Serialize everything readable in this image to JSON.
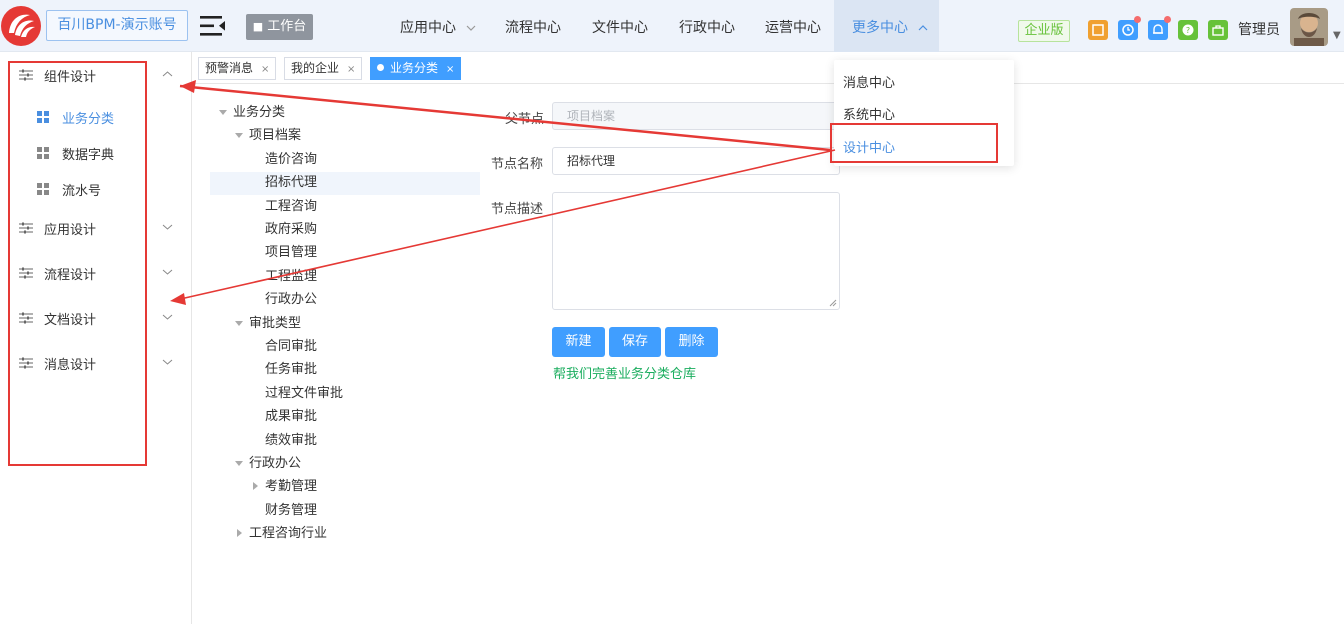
{
  "header": {
    "account_label": "百川BPM-演示账号",
    "workbench_label": "工作台",
    "nav": [
      {
        "label": "应用中心",
        "has_chevron": true
      },
      {
        "label": "流程中心",
        "has_chevron": false
      },
      {
        "label": "文件中心",
        "has_chevron": false
      },
      {
        "label": "行政中心",
        "has_chevron": false
      },
      {
        "label": "运营中心",
        "has_chevron": false
      },
      {
        "label": "更多中心",
        "has_chevron": true,
        "active": true
      }
    ],
    "edition_badge": "企业版",
    "user_name": "管理员",
    "colors": {
      "accent": "#409eff",
      "brand_red": "#e53935",
      "green": "#67c23a"
    }
  },
  "more_menu": {
    "items": [
      "消息中心",
      "系统中心",
      "设计中心"
    ],
    "highlighted": "设计中心"
  },
  "sidebar": {
    "groups": [
      {
        "label": "组件设计",
        "expanded": true,
        "items": [
          {
            "label": "业务分类",
            "active": true
          },
          {
            "label": "数据字典",
            "active": false
          },
          {
            "label": "流水号",
            "active": false
          }
        ]
      },
      {
        "label": "应用设计",
        "expanded": false
      },
      {
        "label": "流程设计",
        "expanded": false
      },
      {
        "label": "文档设计",
        "expanded": false
      },
      {
        "label": "消息设计",
        "expanded": false
      }
    ]
  },
  "tabs": [
    {
      "label": "预警消息",
      "active": false
    },
    {
      "label": "我的企业",
      "active": false
    },
    {
      "label": "业务分类",
      "active": true
    }
  ],
  "tree": [
    {
      "label": "业务分类",
      "level": 0,
      "caret": "down"
    },
    {
      "label": "项目档案",
      "level": 1,
      "caret": "down"
    },
    {
      "label": "造价咨询",
      "level": 2,
      "caret": ""
    },
    {
      "label": "招标代理",
      "level": 2,
      "caret": "",
      "selected": true
    },
    {
      "label": "工程咨询",
      "level": 2,
      "caret": ""
    },
    {
      "label": "政府采购",
      "level": 2,
      "caret": ""
    },
    {
      "label": "项目管理",
      "level": 2,
      "caret": ""
    },
    {
      "label": "工程监理",
      "level": 2,
      "caret": ""
    },
    {
      "label": "行政办公",
      "level": 2,
      "caret": ""
    },
    {
      "label": "审批类型",
      "level": 1,
      "caret": "down"
    },
    {
      "label": "合同审批",
      "level": 2,
      "caret": ""
    },
    {
      "label": "任务审批",
      "level": 2,
      "caret": ""
    },
    {
      "label": "过程文件审批",
      "level": 2,
      "caret": ""
    },
    {
      "label": "成果审批",
      "level": 2,
      "caret": ""
    },
    {
      "label": "绩效审批",
      "level": 2,
      "caret": ""
    },
    {
      "label": "行政办公",
      "level": 1,
      "caret": "down"
    },
    {
      "label": "考勤管理",
      "level": 2,
      "caret": "right"
    },
    {
      "label": "财务管理",
      "level": 2,
      "caret": ""
    },
    {
      "label": "工程咨询行业",
      "level": 1,
      "caret": "right"
    }
  ],
  "form": {
    "parent_label": "父节点",
    "parent_value": "项目档案",
    "name_label": "节点名称",
    "name_value": "招标代理",
    "desc_label": "节点描述",
    "desc_value": "",
    "buttons": {
      "new": "新建",
      "save": "保存",
      "delete": "删除"
    },
    "help_link": "帮我们完善业务分类仓库"
  }
}
